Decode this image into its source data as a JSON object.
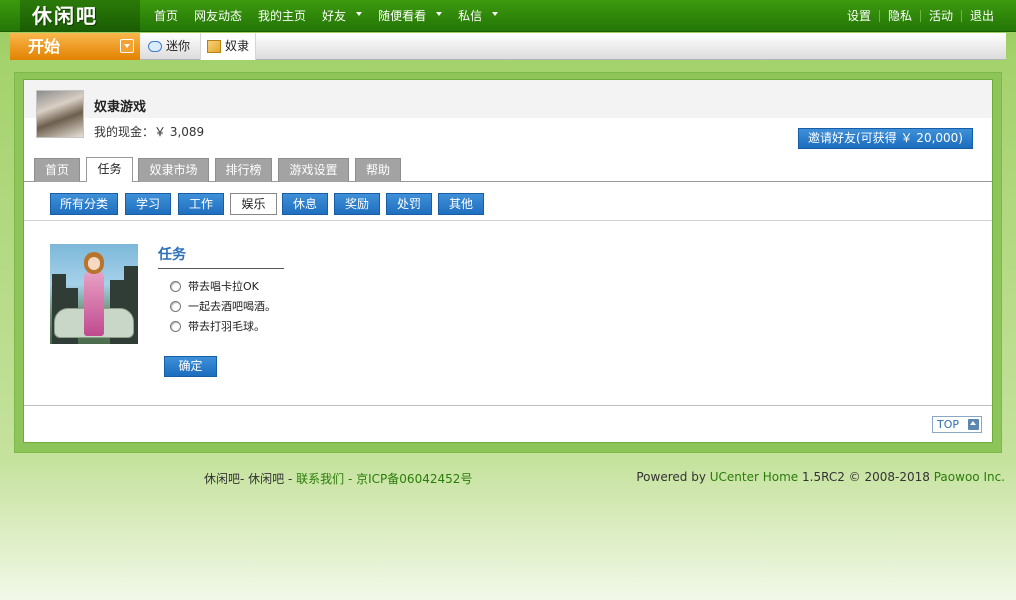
{
  "topbar": {
    "logo": "休闲吧",
    "nav": [
      {
        "label": "首页",
        "dropdown": false
      },
      {
        "label": "网友动态",
        "dropdown": false
      },
      {
        "label": "我的主页",
        "dropdown": false
      },
      {
        "label": "好友",
        "dropdown": true
      },
      {
        "label": "随便看看",
        "dropdown": true
      },
      {
        "label": "私信",
        "dropdown": true
      }
    ],
    "user_links": [
      "设置",
      "隐私",
      "活动",
      "退出"
    ]
  },
  "subbar": {
    "start_label": "开始",
    "apps": [
      {
        "label": "迷你",
        "icon": "chat-bubble-icon"
      },
      {
        "label": "奴隶",
        "icon": "box-icon",
        "active": true
      }
    ]
  },
  "header": {
    "title": "奴隶游戏",
    "cash_label": "我的现金：",
    "cash_value": "￥ 3,089",
    "invite_button": "邀请好友(可获得 ￥ 20,000)"
  },
  "tabs": [
    {
      "label": "首页",
      "active": false
    },
    {
      "label": "任务",
      "active": true
    },
    {
      "label": "奴隶市场",
      "active": false
    },
    {
      "label": "排行榜",
      "active": false
    },
    {
      "label": "游戏设置",
      "active": false
    },
    {
      "label": "帮助",
      "active": false
    }
  ],
  "filters": [
    {
      "label": "所有分类",
      "active": false
    },
    {
      "label": "学习",
      "active": false
    },
    {
      "label": "工作",
      "active": false
    },
    {
      "label": "娱乐",
      "active": true
    },
    {
      "label": "休息",
      "active": false
    },
    {
      "label": "奖励",
      "active": false
    },
    {
      "label": "处罚",
      "active": false
    },
    {
      "label": "其他",
      "active": false
    }
  ],
  "task": {
    "title": "任务",
    "options": [
      "带去唱卡拉OK",
      "一起去酒吧喝酒。",
      "带去打羽毛球。"
    ],
    "confirm_label": "确定"
  },
  "top_button": "TOP",
  "footer": {
    "site_text": "休闲吧- 休闲吧 -",
    "contact_link": "联系我们",
    "dash": "-",
    "icp_link": "京ICP备06042452号",
    "powered_text": "Powered by",
    "ucenter_link": "UCenter Home",
    "version_text": "1.5RC2 © 2008-2018",
    "company_link": "Paowoo Inc."
  }
}
